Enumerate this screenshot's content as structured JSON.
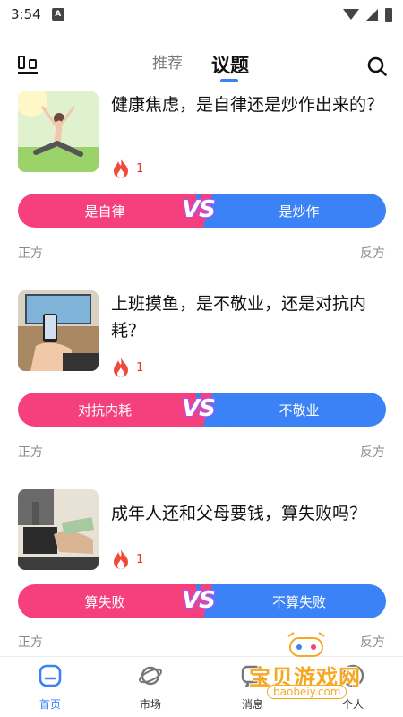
{
  "status_bar": {
    "time": "3:54",
    "app_badge": "A"
  },
  "header": {
    "tabs": [
      {
        "label": "推荐"
      },
      {
        "label": "议题"
      }
    ]
  },
  "topics": [
    {
      "title": "健康焦虑，是自律还是炒作出来的？",
      "heat": "1",
      "left_option": "是自律",
      "right_option": "是炒作",
      "vs": "VS",
      "left_side": "正方",
      "right_side": "反方"
    },
    {
      "title": "上班摸鱼，是不敬业，还是对抗内耗？",
      "heat": "1",
      "left_option": "对抗内耗",
      "right_option": "不敬业",
      "vs": "VS",
      "left_side": "正方",
      "right_side": "反方"
    },
    {
      "title": "成年人还和父母要钱，算失败吗？",
      "heat": "1",
      "left_option": "算失败",
      "right_option": "不算失败",
      "vs": "VS",
      "left_side": "正方",
      "right_side": "反方"
    }
  ],
  "bottom_nav": [
    {
      "label": "首页",
      "active": true
    },
    {
      "label": "市场"
    },
    {
      "label": "消息"
    },
    {
      "label": "个人"
    }
  ],
  "watermark": {
    "title": "宝贝游戏网",
    "url": "baobeiy.com"
  },
  "colors": {
    "pro": "#f6407d",
    "con": "#3a82f6",
    "accent": "#3b82f6",
    "heat": "#e53935"
  }
}
